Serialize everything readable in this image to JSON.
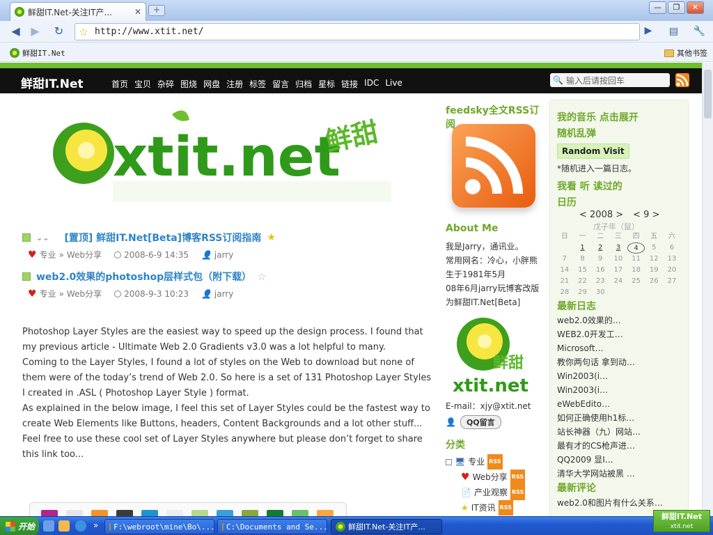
{
  "browser": {
    "tab_title": "鲜甜IT.Net-关注IT产...",
    "tab_close": "✕",
    "new_tab": "+",
    "url": "http://www.xtit.net/",
    "bookmarks": [
      {
        "label": "鲜甜IT.Net"
      }
    ],
    "other_bookmarks": "其他书签",
    "window_buttons": [
      "—",
      "❐",
      "✕"
    ]
  },
  "site": {
    "logo": "鲜甜IT.Net",
    "nav": [
      "首页",
      "宝贝",
      "杂碎",
      "图烧",
      "网盘",
      "注册",
      "标签",
      "留言",
      "归档",
      "星标",
      "链接",
      "IDC",
      "Live"
    ],
    "search_placeholder": "输入后请按回车",
    "banner_text": "xtit.net",
    "banner_tag": "鲜甜"
  },
  "posts": [
    {
      "title": "[置顶] 鲜甜IT.Net[Beta]博客RSS订阅指南",
      "category": "专业",
      "subcategory": "Web分享",
      "date": "2008-6-9 14:35",
      "author": "jarry"
    },
    {
      "title": "web2.0效果的photoshop层样式包（附下载）",
      "category": "专业",
      "subcategory": "Web分享",
      "date": "2008-9-3 10:23",
      "author": "jarry"
    }
  ],
  "article": [
    "Photoshop Layer Styles are the easiest way to speed up the design process. I found that my previous article - Ultimate Web 2.0 Gradients v3.0 was a lot helpful to many.",
    "Coming to the Layer Styles, I found a lot of styles on the Web to download but none of them were of the today’s trend of Web 2.0. So here is a set of 131 Photoshop Layer Styles I created in .ASL ( Photoshop Layer Style ) format.",
    "As explained in the below image, I feel this set of Layer Styles could be the fastest way to create Web Elements like Buttons, headers, Content Backgrounds and a lot other stuff...",
    "Feel free to use these cool set of Layer Styles anywhere but please don’t forget to share this link too..."
  ],
  "swatch_colors": [
    "#b0258e",
    "#e3e7ea",
    "#f5932a",
    "#3b3b3b",
    "#1f93cf",
    "#eceff0",
    "#b8d88e",
    "#3aa0d7",
    "#8aa83a",
    "#137a2f",
    "#6cbf6a",
    "#f7a640"
  ],
  "swatch_colors2": [
    "#8f9aa3",
    "#cfe6ef",
    "#e8e8b8",
    "#f2c14a",
    "#1e6fb0",
    "#e6e6e6",
    "#cce3a5",
    "#b8daf0",
    "#b2cf6c",
    "#1f5f8a",
    "#a9d9b2",
    "#f1c88d"
  ],
  "middle": {
    "feed_title": "feedsky全文RSS订阅",
    "about_title": "About Me",
    "about_lines": [
      "我是Jarry，通讯业。",
      "常用网名：冷心，小胖熊",
      "生于1981年5月",
      "08年6月jarry玩博客改版",
      "为鲜甜IT.Net[Beta]"
    ],
    "logo_text": "xtit.net",
    "logo_tag": "鲜甜",
    "email": "E-mail：xjy@xtit.net",
    "qq_label": "QQ留言",
    "cat_title": "分类",
    "categories": [
      "专业",
      "Web分享",
      "产业观察",
      "IT资讯"
    ],
    "rss_badge": "RSS"
  },
  "right": {
    "music": "我的音乐 点击展开",
    "random": "随机乱弹",
    "random_btn": "Random Visit",
    "random_note": "*随机进入一篇日志。",
    "read": "我看 听 读过的",
    "calendar_title": "日历",
    "cal_year": "< 2008 >",
    "cal_month": "< 9 >",
    "cal_lunar": "戊子年（鼠）",
    "weekdays": [
      "日",
      "一",
      "二",
      "三",
      "四",
      "五",
      "六"
    ],
    "weeks": [
      [
        "",
        "1",
        "2",
        "3",
        "4",
        "5",
        "6"
      ],
      [
        "7",
        "8",
        "9",
        "10",
        "11",
        "12",
        "13"
      ],
      [
        "14",
        "15",
        "16",
        "17",
        "18",
        "19",
        "20"
      ],
      [
        "21",
        "22",
        "23",
        "24",
        "25",
        "26",
        "27"
      ],
      [
        "28",
        "29",
        "30",
        "",
        "",
        "",
        ""
      ]
    ],
    "recent_title": "最新日志",
    "recent": [
      "web2.0效果的…",
      "WEB2.0开发工…",
      "Microsoft…",
      "教你两句话 拿到动…",
      "Win2003(i…",
      "Win2003(i…",
      "eWebEdito…",
      "如何正确使用h1标…",
      "站长神器（九）网站…",
      "最有才的CS枪声进…",
      "QQ2009 显I…",
      "清华大学网站被黑 …"
    ],
    "comments_title": "最新评论",
    "comments": [
      "web2.0和图片有什么关系…"
    ]
  },
  "taskbar": {
    "start": "开始",
    "tasks": [
      "F:\\webroot\\mine\\Bo\\...",
      "C:\\Documents and Se...",
      "鲜甜IT.Net-关注IT产..."
    ],
    "tray_top": "鲜甜IT.Net",
    "tray_bottom": "xtit.net"
  }
}
